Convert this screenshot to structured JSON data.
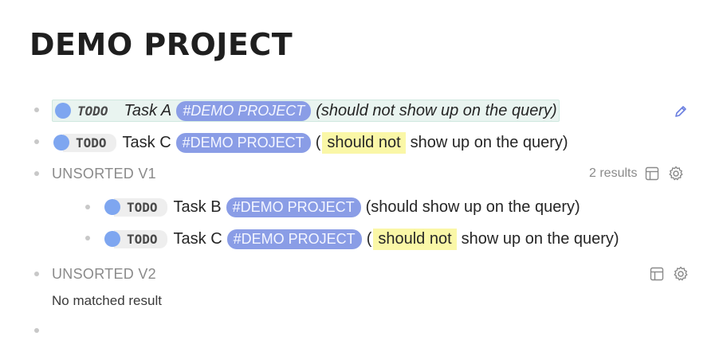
{
  "page": {
    "title": "DEMO PROJECT"
  },
  "blocks": [
    {
      "marker": "TODO",
      "task": "Task A",
      "tag": "#DEMO PROJECT",
      "suffix": "(should not show up on the query)"
    },
    {
      "marker": "TODO",
      "task": "Task C",
      "tag": "#DEMO PROJECT",
      "open_paren": "(",
      "highlight": "should not",
      "suffix": "show up on the query)"
    }
  ],
  "query_v1": {
    "label": "UNSORTED V1",
    "results_count": "2 results",
    "items": [
      {
        "marker": "TODO",
        "task": "Task B",
        "tag": "#DEMO PROJECT",
        "suffix": "(should show up on the query)"
      },
      {
        "marker": "TODO",
        "task": "Task C",
        "tag": "#DEMO PROJECT",
        "open_paren": "(",
        "highlight": "should not",
        "suffix": "show up on the query)"
      }
    ]
  },
  "query_v2": {
    "label": "UNSORTED V2",
    "empty_text": "No matched result"
  },
  "icons": {
    "edit": "pencil-icon",
    "table": "table-icon",
    "settings": "gear-icon"
  },
  "colors": {
    "marker_dot": "#7ea6f0",
    "tag_bg": "#8a9de6",
    "highlight_bg": "#faf7a7",
    "edit_icon": "#6b7fe0"
  }
}
